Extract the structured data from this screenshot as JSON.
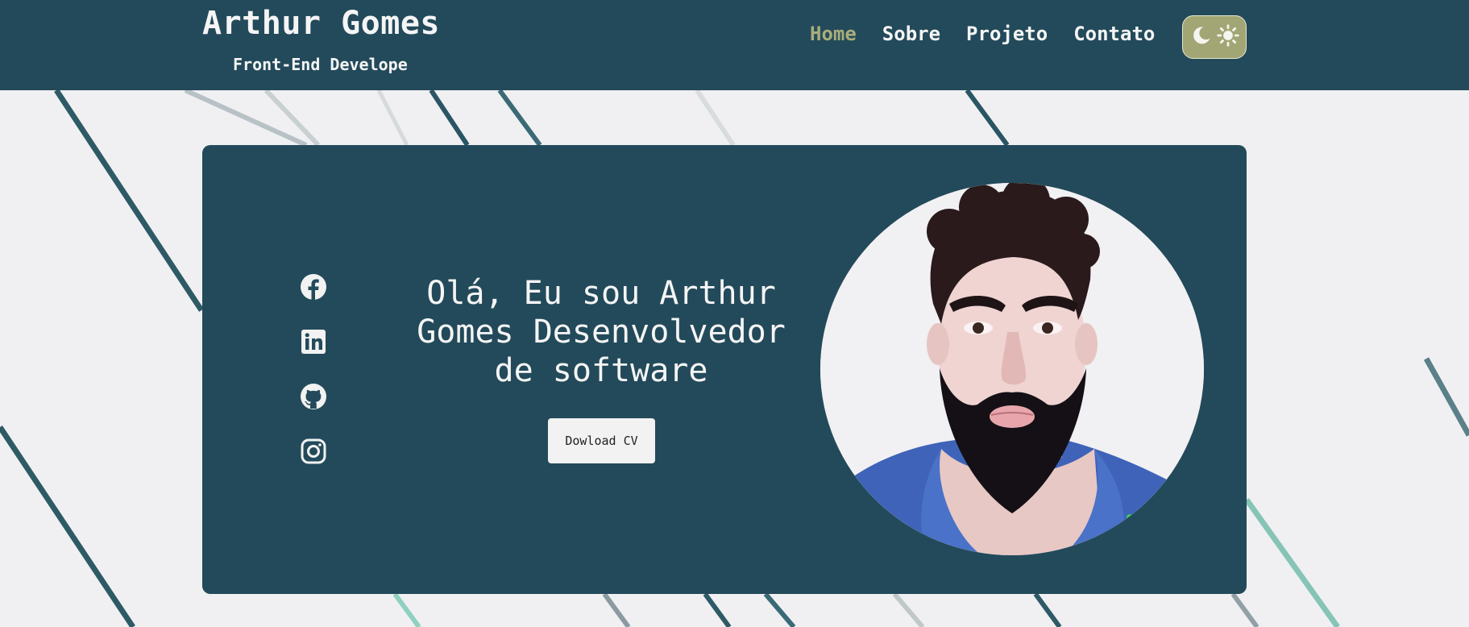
{
  "header": {
    "brand_name": "Arthur Gomes",
    "brand_role": "Front-End Develope",
    "nav": [
      {
        "label": "Home",
        "active": true
      },
      {
        "label": "Sobre",
        "active": false
      },
      {
        "label": "Projeto",
        "active": false
      },
      {
        "label": "Contato",
        "active": false
      }
    ],
    "theme_toggle": {
      "icons": [
        "moon-icon",
        "sun-icon"
      ]
    }
  },
  "hero": {
    "title": "Olá, Eu sou Arthur Gomes Desenvolvedor de software",
    "cv_button": "Dowload CV",
    "socials": [
      "facebook-icon",
      "linkedin-icon",
      "github-icon",
      "instagram-icon"
    ],
    "avatar": "profile-photo"
  },
  "colors": {
    "primary": "#234a5a",
    "accent": "#a8ad7a",
    "background": "#f0f0f2",
    "text_light": "#f5f5f5"
  }
}
